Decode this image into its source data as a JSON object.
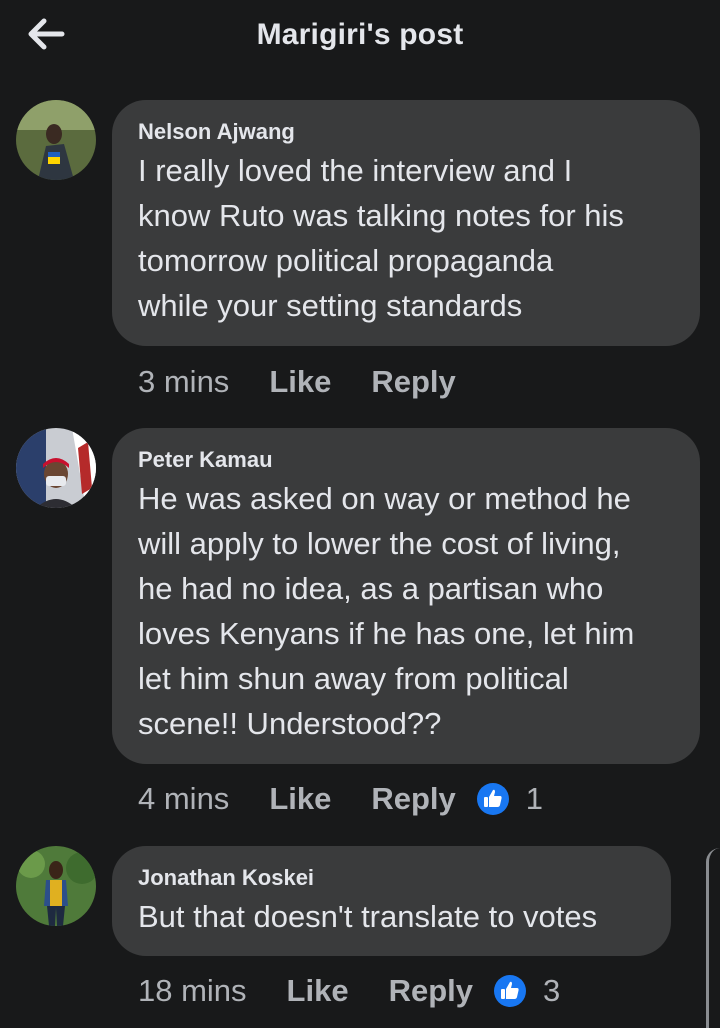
{
  "header": {
    "title": "Marigiri's post",
    "back_icon": "arrow-left-icon"
  },
  "colors": {
    "background": "#18191a",
    "bubble": "#3a3b3c",
    "text": "#e4e6eb",
    "muted": "#b0b3b8",
    "like_blue": "#1877f2"
  },
  "comments": [
    {
      "author": "Nelson Ajwang",
      "text": "I really loved the interview and I\nknow Ruto was talking notes for his\ntomorrow political propaganda\nwhile your setting standards",
      "time": "3 mins",
      "like_label": "Like",
      "reply_label": "Reply",
      "reactions": null
    },
    {
      "author": "Peter Kamau",
      "text": "He was asked on way or method he\nwill apply to lower the cost of living,\nhe had no idea, as a partisan who\nloves Kenyans if he has one, let him\nlet him shun away from political\nscene!! Understood??",
      "time": "4 mins",
      "like_label": "Like",
      "reply_label": "Reply",
      "reactions": "1"
    },
    {
      "author": "Jonathan Koskei",
      "text": "But that doesn't translate to votes",
      "time": "18 mins",
      "like_label": "Like",
      "reply_label": "Reply",
      "reactions": "3"
    }
  ]
}
